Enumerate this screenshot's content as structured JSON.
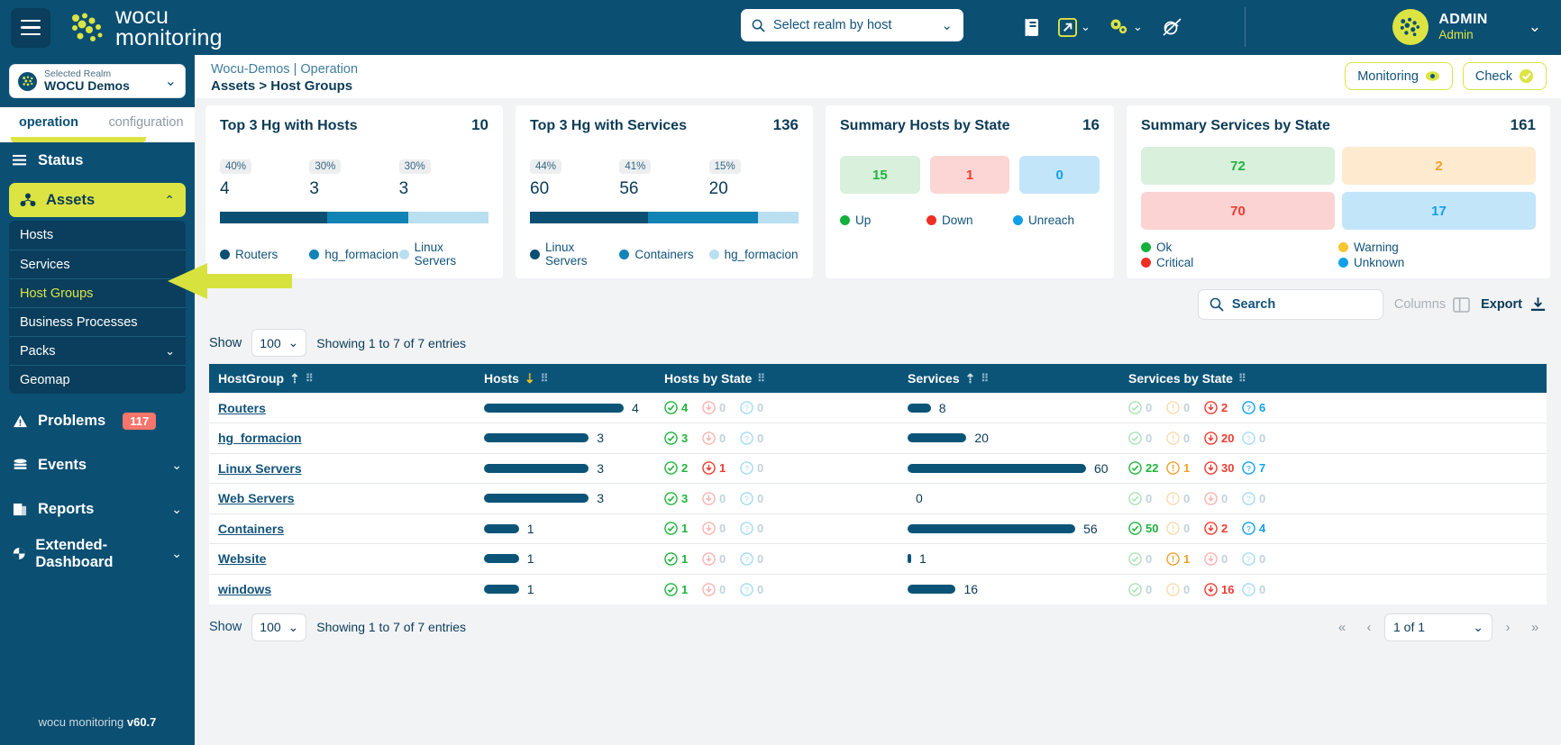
{
  "topbar": {
    "menu_icon": "hamburger-icon",
    "brand_line1": "wocu",
    "brand_line2": "monitoring",
    "realm_search_placeholder": "Select realm by host",
    "icons": [
      "book-icon",
      "external-link-icon",
      "gears-icon",
      "mute-notification-icon"
    ],
    "user_name": "ADMIN",
    "user_role": "Admin"
  },
  "sidebar": {
    "realm_label": "Selected Realm",
    "realm_value": "WOCU Demos",
    "tabs": [
      {
        "label": "operation",
        "active": true
      },
      {
        "label": "configuration",
        "active": false
      }
    ],
    "nav": [
      {
        "label": "Status",
        "icon": "list-icon"
      },
      {
        "label": "Assets",
        "icon": "assets-icon",
        "highlight": true,
        "caret": "⌃"
      }
    ],
    "sub_items": [
      {
        "label": "Hosts"
      },
      {
        "label": "Services"
      },
      {
        "label": "Host Groups",
        "selected": true
      },
      {
        "label": "Business Processes"
      },
      {
        "label": "Packs",
        "caret": "⌄"
      },
      {
        "label": "Geomap"
      }
    ],
    "nav2": [
      {
        "label": "Problems",
        "icon": "warning-icon",
        "badge": "117"
      },
      {
        "label": "Events",
        "icon": "database-icon",
        "caret": "⌄"
      },
      {
        "label": "Reports",
        "icon": "document-icon",
        "caret": "⌄"
      },
      {
        "label": "Extended-Dashboard",
        "icon": "dashboard-icon",
        "caret": "⌄"
      }
    ],
    "version_prefix": "wocu monitoring ",
    "version": "v60.7"
  },
  "breadcrumb": {
    "line1": "Wocu-Demos | Operation",
    "line2": "Assets > Host Groups",
    "monitoring_label": "Monitoring",
    "check_label": "Check"
  },
  "chart_data": [
    {
      "type": "bar",
      "title": "Top 3 Hg with Hosts",
      "total": "10",
      "categories": [
        "Routers",
        "hg_formacion",
        "Linux Servers"
      ],
      "values": [
        4,
        3,
        3
      ],
      "percents": [
        "40%",
        "30%",
        "30%"
      ],
      "colors": [
        "#0b4f73",
        "#1183b5",
        "#b9dff0"
      ],
      "legend_position": "bottom"
    },
    {
      "type": "bar",
      "title": "Top 3 Hg with Services",
      "total": "136",
      "categories": [
        "Linux Servers",
        "Containers",
        "hg_formacion"
      ],
      "values": [
        60,
        56,
        20
      ],
      "percents": [
        "44%",
        "41%",
        "15%"
      ],
      "colors": [
        "#0b4f73",
        "#1183b5",
        "#b9dff0"
      ],
      "legend_position": "bottom"
    },
    {
      "type": "bar",
      "title": "Summary Hosts by State",
      "total": "16",
      "categories": [
        "Up",
        "Down",
        "Unreach"
      ],
      "values": [
        15,
        1,
        0
      ],
      "tile_bg": [
        "#d8f0dc",
        "#fcd6d4",
        "#c3e5fa"
      ],
      "tile_fg": [
        "#1eb43c",
        "#ee3b31",
        "#10a0e8"
      ],
      "dot_colors": [
        "#13b03c",
        "#ee2f25",
        "#10a0e8"
      ],
      "legend_position": "bottom"
    },
    {
      "type": "bar",
      "title": "Summary Services by State",
      "total": "161",
      "categories": [
        "Ok",
        "Warning",
        "Critical",
        "Unknown"
      ],
      "values": [
        72,
        2,
        70,
        17
      ],
      "tile_bg": [
        "#d9f0dc",
        "#fdeacf",
        "#fbd3d2",
        "#c3e5fa"
      ],
      "tile_fg": [
        "#1eb43c",
        "#f0a02a",
        "#ee3b31",
        "#10a0e8"
      ],
      "dot_colors": [
        "#13b03c",
        "#f8c630",
        "#ee2f25",
        "#10a0e8"
      ],
      "legend_position": "bottom"
    }
  ],
  "toolbar": {
    "search_placeholder": "Search",
    "columns_label": "Columns",
    "export_label": "Export"
  },
  "table_controls": {
    "show_label": "Show",
    "page_size": "100",
    "showing_text": "Showing 1 to 7 of 7 entries",
    "page_indicator": "1 of 1"
  },
  "table": {
    "columns": [
      {
        "label": "HostGroup",
        "sort": "asc"
      },
      {
        "label": "Hosts",
        "sort": "desc"
      },
      {
        "label": "Hosts by State",
        "sort": "none"
      },
      {
        "label": "Services",
        "sort": "asc"
      },
      {
        "label": "Services by State",
        "sort": "none"
      }
    ],
    "rows": [
      {
        "name": "Routers",
        "hosts": "4",
        "hosts_bar": 100,
        "hs": [
          "4",
          "0",
          "0"
        ],
        "services": "8",
        "services_bar": 13,
        "ss": [
          "0",
          "0",
          "2",
          "6"
        ]
      },
      {
        "name": "hg_formacion",
        "hosts": "3",
        "hosts_bar": 75,
        "hs": [
          "3",
          "0",
          "0"
        ],
        "services": "20",
        "services_bar": 33,
        "ss": [
          "0",
          "0",
          "20",
          "0"
        ]
      },
      {
        "name": "Linux Servers",
        "hosts": "3",
        "hosts_bar": 75,
        "hs": [
          "2",
          "1",
          "0"
        ],
        "services": "60",
        "services_bar": 100,
        "ss": [
          "22",
          "1",
          "30",
          "7"
        ]
      },
      {
        "name": "Web Servers",
        "hosts": "3",
        "hosts_bar": 75,
        "hs": [
          "3",
          "0",
          "0"
        ],
        "services": "0",
        "services_bar": 0,
        "ss": [
          "0",
          "0",
          "0",
          "0"
        ]
      },
      {
        "name": "Containers",
        "hosts": "1",
        "hosts_bar": 25,
        "hs": [
          "1",
          "0",
          "0"
        ],
        "services": "56",
        "services_bar": 94,
        "ss": [
          "50",
          "0",
          "2",
          "4"
        ]
      },
      {
        "name": "Website",
        "hosts": "1",
        "hosts_bar": 25,
        "hs": [
          "1",
          "0",
          "0"
        ],
        "services": "1",
        "services_bar": 2,
        "ss": [
          "0",
          "1",
          "0",
          "0"
        ]
      },
      {
        "name": "windows",
        "hosts": "1",
        "hosts_bar": 25,
        "hs": [
          "1",
          "0",
          "0"
        ],
        "services": "16",
        "services_bar": 27,
        "ss": [
          "0",
          "0",
          "16",
          "0"
        ]
      }
    ]
  }
}
